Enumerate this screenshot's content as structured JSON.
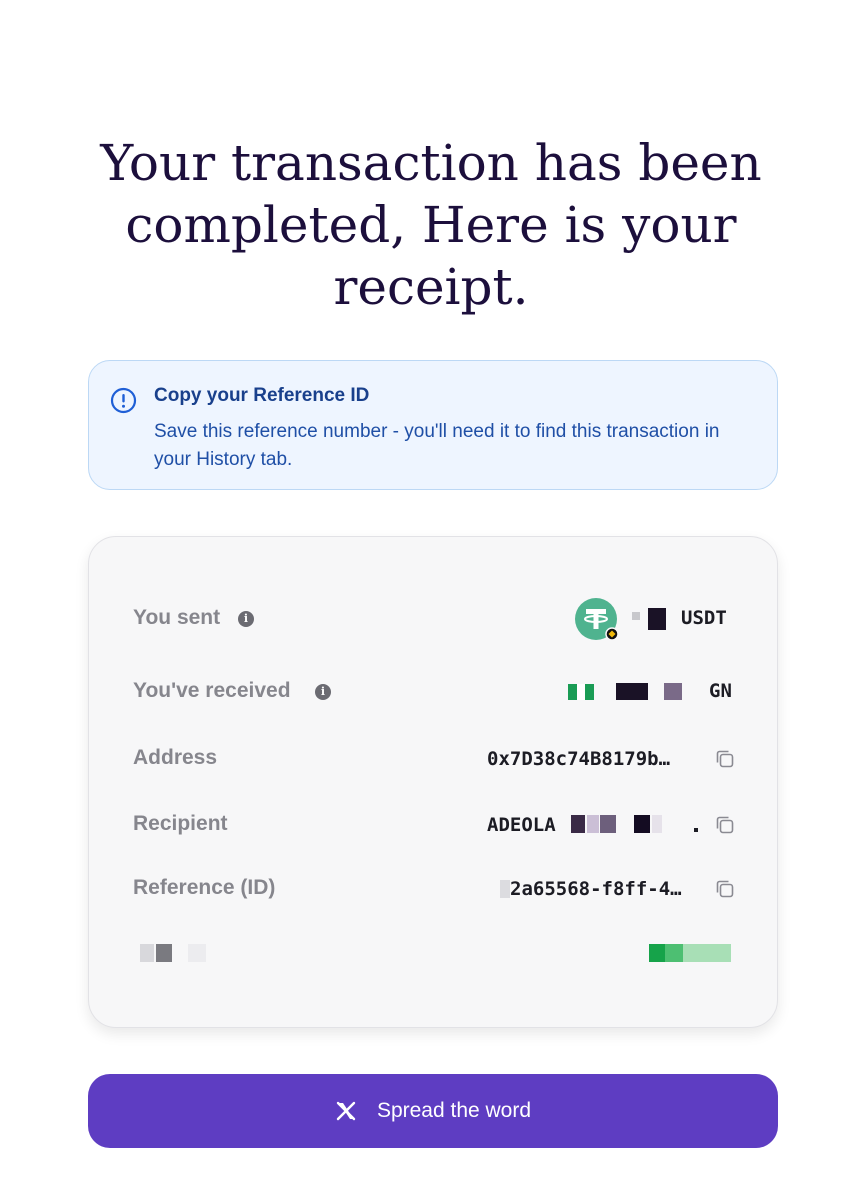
{
  "header": {
    "title_lines": [
      "Your transaction has been",
      "completed, Here is your",
      "receipt."
    ]
  },
  "notice": {
    "icon": "info-circle-icon",
    "title": "Copy your Reference ID",
    "body": "Save this reference number - you'll need it to find this transaction in your History tab.",
    "colors": {
      "background": "#eef5ff",
      "border": "#bcd8f5",
      "text": "#1f4fa6"
    }
  },
  "receipt": {
    "sent": {
      "label": "You sent",
      "token_icon": "tether-usdt-icon",
      "amount_redacted": true,
      "currency": "USDT"
    },
    "received": {
      "label": "You've received",
      "flag_icon": "nigeria-flag-icon",
      "amount_redacted": true,
      "currency_partial": "GN"
    },
    "address": {
      "label": "Address",
      "value": "0x7D38c74B8179b…",
      "copy_icon": "copy-icon"
    },
    "recipient": {
      "label": "Recipient",
      "value": "ADEOLA",
      "copy_icon": "copy-icon"
    },
    "reference": {
      "label": "Reference (ID)",
      "value": "2a65568-f8ff-4…",
      "copy_icon": "copy-icon"
    },
    "status_redacted": true
  },
  "actions": {
    "spread": {
      "label": "Spread the word",
      "icon": "x-logo-icon",
      "color": "#5e3dc2"
    }
  }
}
